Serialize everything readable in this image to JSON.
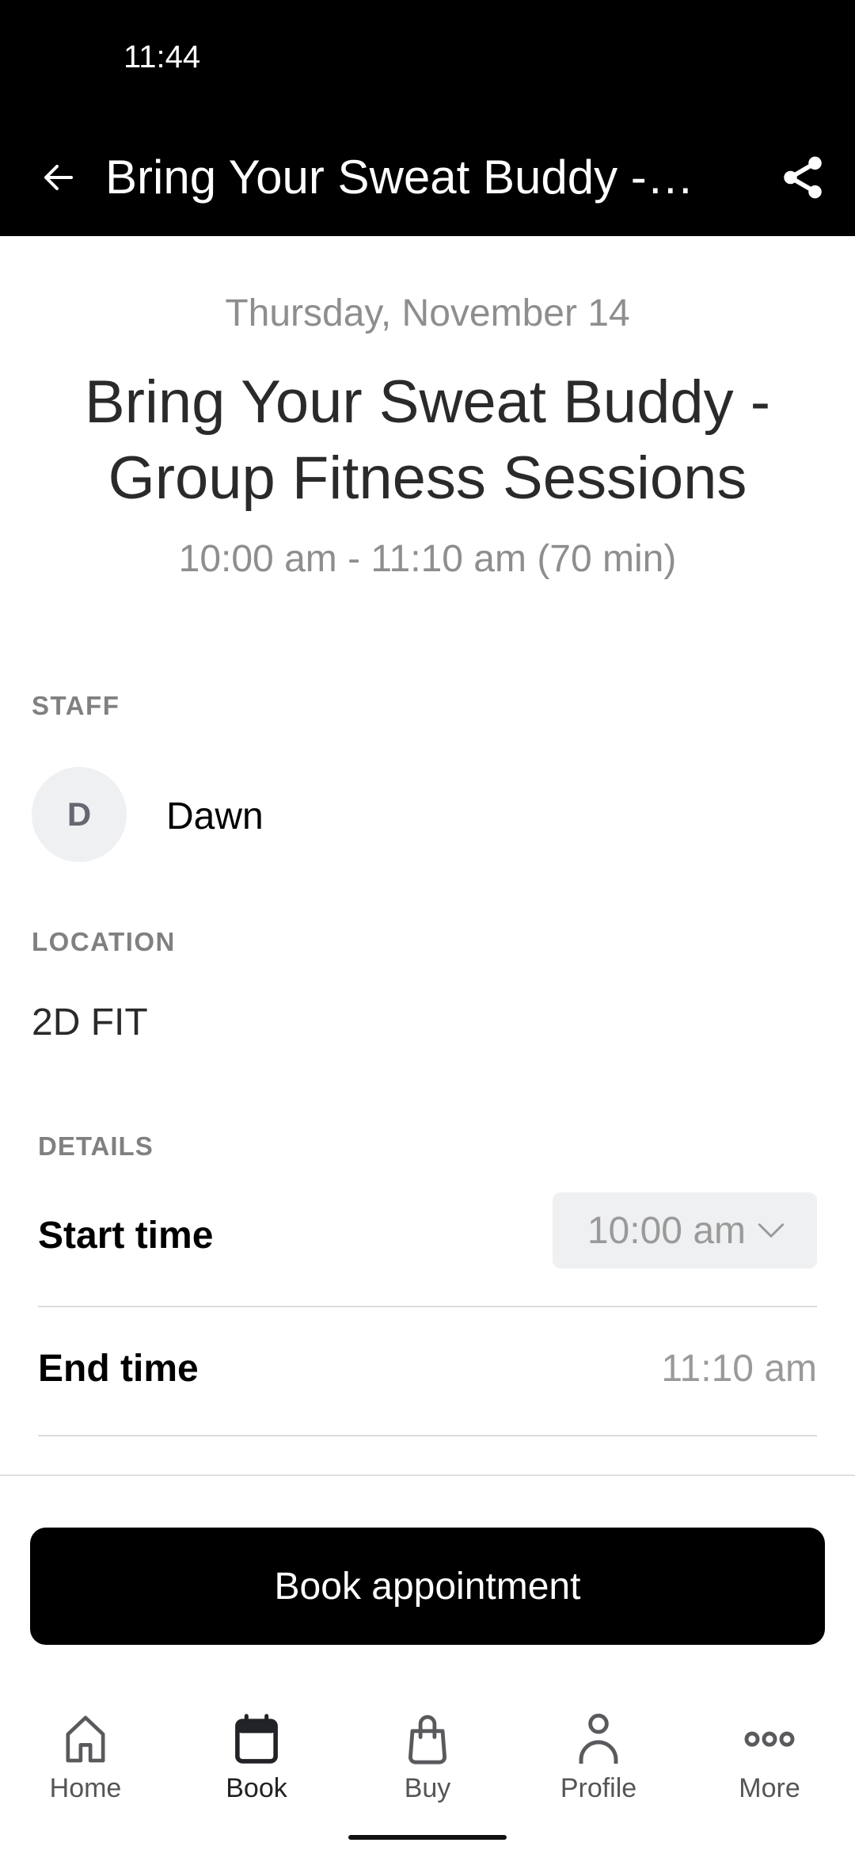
{
  "status_bar": {
    "time": "11:44"
  },
  "toolbar": {
    "title": "Bring Your Sweat Buddy -…",
    "back_icon": "arrow-left-icon",
    "share_icon": "share-icon"
  },
  "class": {
    "date": "Thursday, November 14",
    "title": "Bring Your Sweat Buddy - Group Fitness Sessions",
    "time_range": "10:00 am - 11:10 am (70 min)"
  },
  "staff": {
    "label": "STAFF",
    "avatar_initial": "D",
    "name": "Dawn"
  },
  "location": {
    "label": "LOCATION",
    "value": "2D FIT"
  },
  "details": {
    "label": "DETAILS",
    "start_time_label": "Start time",
    "start_time_value": "10:00 am",
    "end_time_label": "End time",
    "end_time_value": "11:10 am"
  },
  "actions": {
    "book_label": "Book appointment"
  },
  "bottom_nav": {
    "items": [
      {
        "label": "Home",
        "icon": "home-icon",
        "active": false
      },
      {
        "label": "Book",
        "icon": "calendar-icon",
        "active": true
      },
      {
        "label": "Buy",
        "icon": "shopping-bag-icon",
        "active": false
      },
      {
        "label": "Profile",
        "icon": "person-icon",
        "active": false
      },
      {
        "label": "More",
        "icon": "more-horizontal-icon",
        "active": false
      }
    ]
  },
  "colors": {
    "header_bg": "#000000",
    "primary_button": "#000000",
    "muted_text": "#8e8e8e",
    "chip_bg": "#eff0f2"
  }
}
